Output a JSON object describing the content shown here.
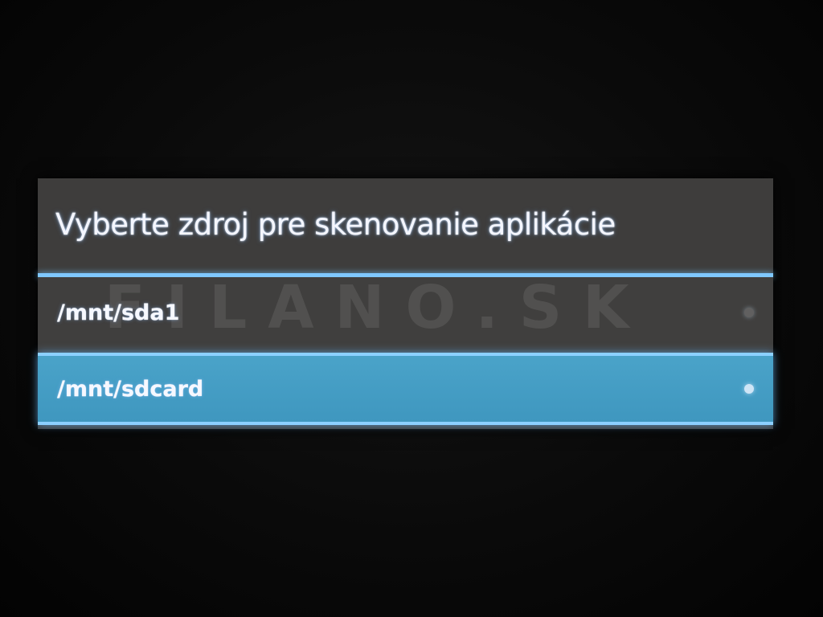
{
  "dialog": {
    "title": "Vyberte zdroj pre skenovanie aplikácie",
    "items": [
      {
        "label": "/mnt/sda1",
        "selected": false
      },
      {
        "label": "/mnt/sdcard",
        "selected": true
      }
    ]
  },
  "watermark": "FILANO.SK",
  "colors": {
    "dialog_background": "#3e3d3c",
    "accent": "#7fc8ff",
    "selected_item": "#4aa3c9",
    "text": "#f4f6ff"
  }
}
